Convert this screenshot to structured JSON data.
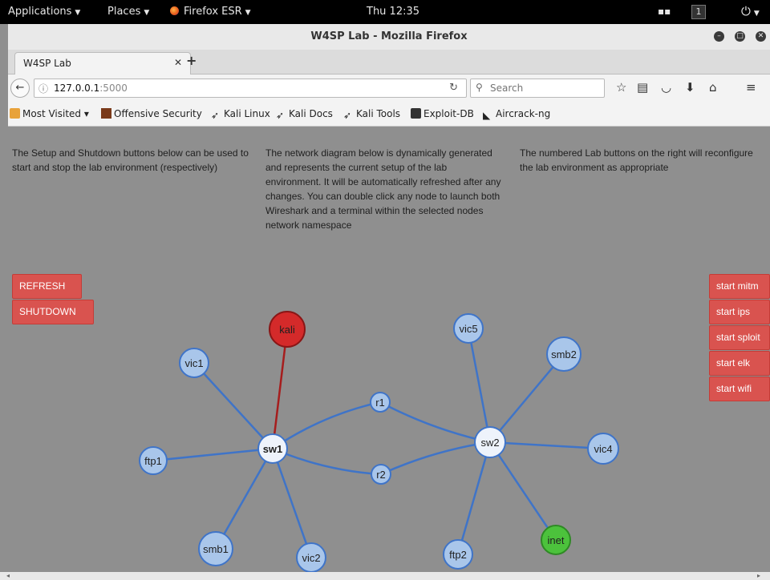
{
  "system_bar": {
    "applications": "Applications",
    "places": "Places",
    "firefox": "Firefox ESR",
    "clock": "Thu 12:35",
    "workspace": "1"
  },
  "window": {
    "title": "W4SP Lab - Mozilla Firefox"
  },
  "tab": {
    "title": "W4SP Lab"
  },
  "nav": {
    "url_host": "127.0.0.1",
    "url_port": ":5000",
    "search_placeholder": "Search"
  },
  "bookmarks": [
    "Most Visited ▾",
    "Offensive Security",
    "Kali Linux",
    "Kali Docs",
    "Kali Tools",
    "Exploit-DB",
    "Aircrack-ng"
  ],
  "page": {
    "desc_left": "The Setup and Shutdown buttons below can be used to start and stop the lab environment (respectively)",
    "desc_middle": "The network diagram below is dynamically generated and represents the current setup of the lab environment. It will be automatically refreshed after any changes. You can double click any node to launch both Wireshark and a terminal within the selected nodes network namespace",
    "desc_right": "The numbered Lab buttons on the right will reconfigure the lab environment as appropriate",
    "refresh_label": "REFRESH",
    "shutdown_label": "SHUTDOWN",
    "lab_buttons": [
      "start mitm",
      "start ips",
      "start sploit",
      "start elk",
      "start wifi"
    ]
  },
  "network": {
    "colors": {
      "node": "#a9c6ea",
      "switch": "#eef3fb",
      "attacker": "#d42a2a",
      "gateway": "#4cc23c",
      "link": "#3f74c8",
      "attack_link": "#a61d1d"
    },
    "nodes": [
      {
        "id": "kali",
        "role": "attacker"
      },
      {
        "id": "vic1",
        "role": "host"
      },
      {
        "id": "sw1",
        "role": "switch"
      },
      {
        "id": "r1",
        "role": "router"
      },
      {
        "id": "r2",
        "role": "router"
      },
      {
        "id": "ftp1",
        "role": "host"
      },
      {
        "id": "smb1",
        "role": "host"
      },
      {
        "id": "vic2",
        "role": "host"
      },
      {
        "id": "vic5",
        "role": "host"
      },
      {
        "id": "smb2",
        "role": "host"
      },
      {
        "id": "sw2",
        "role": "switch"
      },
      {
        "id": "vic4",
        "role": "host"
      },
      {
        "id": "ftp2",
        "role": "host"
      },
      {
        "id": "inet",
        "role": "gateway"
      }
    ],
    "links": [
      [
        "sw1",
        "kali"
      ],
      [
        "sw1",
        "vic1"
      ],
      [
        "sw1",
        "ftp1"
      ],
      [
        "sw1",
        "smb1"
      ],
      [
        "sw1",
        "vic2"
      ],
      [
        "sw1",
        "r1"
      ],
      [
        "sw1",
        "r2"
      ],
      [
        "r1",
        "sw2"
      ],
      [
        "r2",
        "sw2"
      ],
      [
        "sw2",
        "vic5"
      ],
      [
        "sw2",
        "smb2"
      ],
      [
        "sw2",
        "vic4"
      ],
      [
        "sw2",
        "ftp2"
      ],
      [
        "sw2",
        "inet"
      ]
    ]
  }
}
